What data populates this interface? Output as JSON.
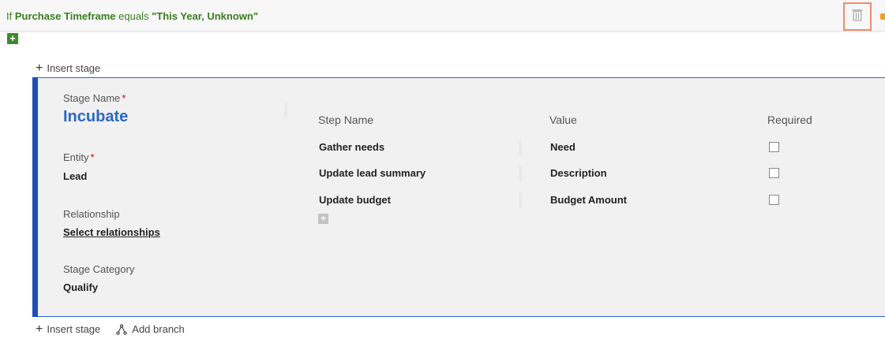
{
  "condition": {
    "prefix": "If",
    "field": "Purchase Timeframe",
    "operator": "equals",
    "value": "\"This Year, Unknown\""
  },
  "top_actions": {
    "insert_stage_label": "Insert stage"
  },
  "stage": {
    "stage_name_label": "Stage Name",
    "stage_name_value": "Incubate",
    "entity_label": "Entity",
    "entity_value": "Lead",
    "relationship_label": "Relationship",
    "relationship_value": "Select relationships",
    "stage_category_label": "Stage Category",
    "stage_category_value": "Qualify",
    "required_marker": "*"
  },
  "steps": {
    "headers": {
      "step_name": "Step Name",
      "value": "Value",
      "required": "Required"
    },
    "rows": [
      {
        "step_name": "Gather needs",
        "value": "Need",
        "required": false
      },
      {
        "step_name": "Update lead summary",
        "value": "Description",
        "required": false
      },
      {
        "step_name": "Update budget",
        "value": "Budget Amount",
        "required": false
      }
    ]
  },
  "bottom_actions": {
    "insert_stage_label": "Insert stage",
    "add_branch_label": "Add branch"
  },
  "colors": {
    "condition_text": "#3a7d1e",
    "stage_accent": "#1e4fb8",
    "stage_name": "#2a67c6",
    "delete_highlight": "#ee8d6b",
    "required_star": "#d0021b"
  },
  "icons": {
    "delete": "trash-icon",
    "add_condition": "plus-icon",
    "insert_stage": "plus-icon",
    "add_branch": "branch-icon",
    "add_step": "plus-icon"
  }
}
